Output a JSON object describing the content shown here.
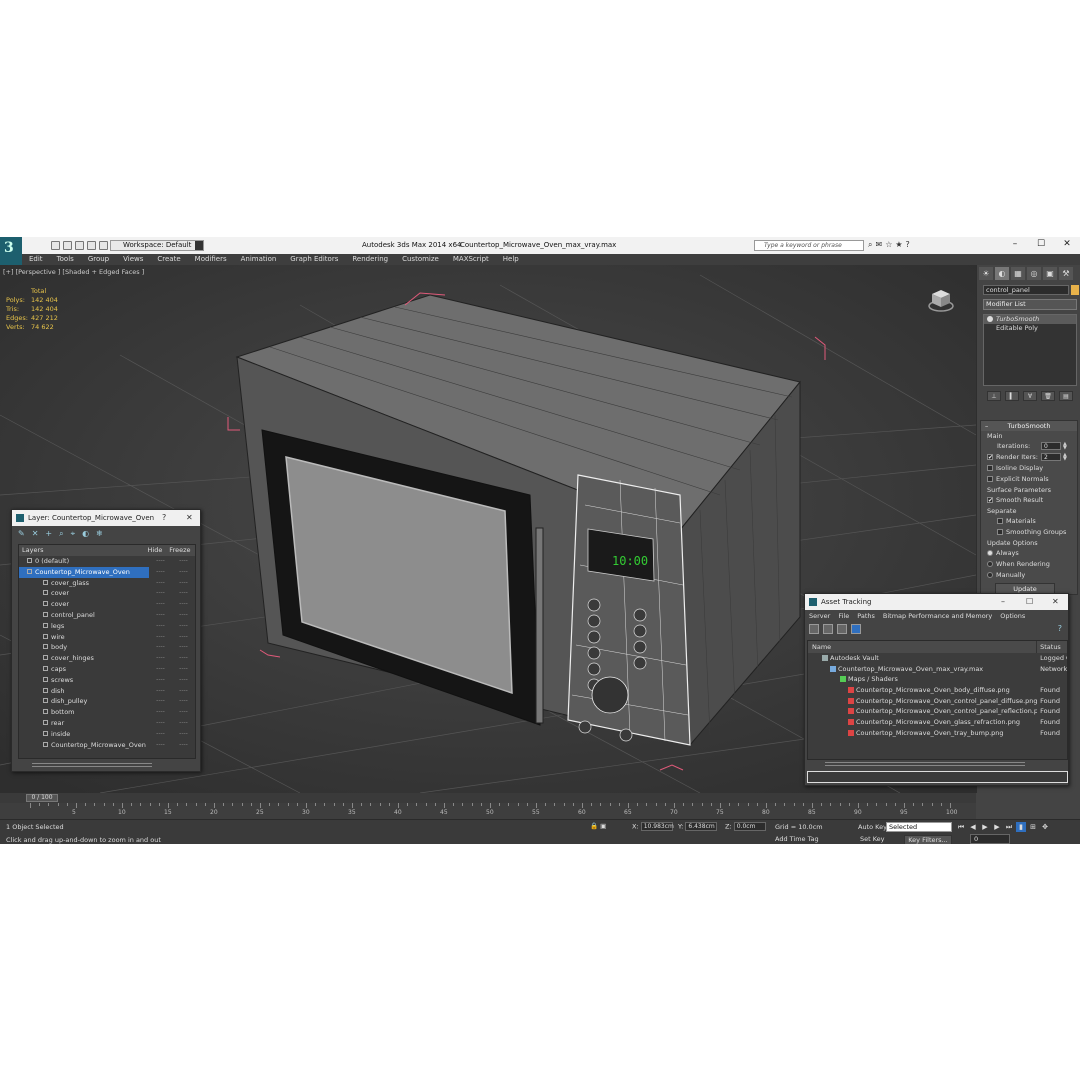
{
  "titlebar": {
    "workspace": "Workspace: Default",
    "app_title": "Autodesk 3ds Max  2014 x64",
    "file_title": "Countertop_Microwave_Oven_max_vray.max",
    "search_placeholder": "Type a keyword or phrase",
    "help": "?",
    "minimize": "–",
    "maximize": "☐",
    "close": "✕"
  },
  "menu": [
    "Edit",
    "Tools",
    "Group",
    "Views",
    "Create",
    "Modifiers",
    "Animation",
    "Graph Editors",
    "Rendering",
    "Customize",
    "MAXScript",
    "Help"
  ],
  "viewport": {
    "label": "[+] [Perspective ] [Shaded + Edged Faces ]",
    "stats_header": "Total",
    "stats": [
      {
        "k": "Polys:",
        "v": "142 404"
      },
      {
        "k": "Tris:",
        "v": "142 404"
      },
      {
        "k": "Edges:",
        "v": "427 212"
      },
      {
        "k": "Verts:",
        "v": "74 622"
      }
    ],
    "clock_text": "10:00"
  },
  "command_panel": {
    "object_name": "control_panel",
    "object_color": "#e8b24a",
    "modifier_list": "Modifier List",
    "stack": [
      "TurboSmooth",
      "Editable Poly"
    ],
    "rollout_title": "TurboSmooth",
    "main_group": "Main",
    "iterations_label": "Iterations:",
    "iterations_value": "0",
    "render_iters_label": "Render Iters:",
    "render_iters_value": "2",
    "isoline": "Isoline Display",
    "explicit": "Explicit Normals",
    "surface_group": "Surface Parameters",
    "smooth_result": "Smooth Result",
    "separate": "Separate",
    "materials": "Materials",
    "smoothing_groups": "Smoothing Groups",
    "update_group": "Update Options",
    "always": "Always",
    "when_rendering": "When Rendering",
    "manually": "Manually",
    "update_button": "Update"
  },
  "layer_window": {
    "title": "Layer: Countertop_Microwave_Oven",
    "help": "?",
    "close": "✕",
    "col_layers": "Layers",
    "col_hide": "Hide",
    "col_freeze": "Freeze",
    "rows": [
      {
        "name": "0 (default)",
        "type": "layer"
      },
      {
        "name": "Countertop_Microwave_Oven",
        "type": "layer-sel"
      },
      {
        "name": "cover_glass",
        "type": "obj"
      },
      {
        "name": "cover",
        "type": "obj"
      },
      {
        "name": "cover",
        "type": "obj"
      },
      {
        "name": "control_panel",
        "type": "obj"
      },
      {
        "name": "legs",
        "type": "obj"
      },
      {
        "name": "wire",
        "type": "obj"
      },
      {
        "name": "body",
        "type": "obj"
      },
      {
        "name": "cover_hinges",
        "type": "obj"
      },
      {
        "name": "caps",
        "type": "obj"
      },
      {
        "name": "screws",
        "type": "obj"
      },
      {
        "name": "dish",
        "type": "obj"
      },
      {
        "name": "dish_pulley",
        "type": "obj"
      },
      {
        "name": "bottom",
        "type": "obj"
      },
      {
        "name": "rear",
        "type": "obj"
      },
      {
        "name": "inside",
        "type": "obj"
      },
      {
        "name": "Countertop_Microwave_Oven",
        "type": "obj"
      }
    ],
    "dash": "----"
  },
  "asset_window": {
    "title": "Asset Tracking",
    "minimize": "–",
    "maximize": "☐",
    "close": "✕",
    "menu": [
      "Server",
      "File",
      "Paths",
      "Bitmap Performance and Memory",
      "Options"
    ],
    "col_name": "Name",
    "col_status": "Status",
    "rows": [
      {
        "name": "Autodesk Vault",
        "status": "Logged Out",
        "indent": 14,
        "color": "#9aa"
      },
      {
        "name": "Countertop_Microwave_Oven_max_vray.max",
        "status": "Network",
        "indent": 22,
        "color": "#7ad"
      },
      {
        "name": "Maps / Shaders",
        "status": "",
        "indent": 32,
        "color": "#5c5"
      },
      {
        "name": "Countertop_Microwave_Oven_body_diffuse.png",
        "status": "Found",
        "indent": 40,
        "color": "#d44"
      },
      {
        "name": "Countertop_Microwave_Oven_control_panel_diffuse.png",
        "status": "Found",
        "indent": 40,
        "color": "#d44"
      },
      {
        "name": "Countertop_Microwave_Oven_control_panel_reflection.png",
        "status": "Found",
        "indent": 40,
        "color": "#d44"
      },
      {
        "name": "Countertop_Microwave_Oven_glass_refraction.png",
        "status": "Found",
        "indent": 40,
        "color": "#d44"
      },
      {
        "name": "Countertop_Microwave_Oven_tray_bump.png",
        "status": "Found",
        "indent": 40,
        "color": "#d44"
      }
    ]
  },
  "timeline": {
    "frame": "0 / 100",
    "ticks": [
      "5",
      "10",
      "15",
      "20",
      "25",
      "30",
      "35",
      "40",
      "45",
      "50",
      "55",
      "60",
      "65",
      "70",
      "75",
      "80",
      "85",
      "90",
      "95",
      "100"
    ]
  },
  "status": {
    "selected": "1 Object Selected",
    "hint": "Click and drag up-and-down to zoom in and out",
    "x_label": "X:",
    "x_value": "10.983cm",
    "y_label": "Y:",
    "y_value": "6.438cm",
    "z_label": "Z:",
    "z_value": "0.0cm",
    "grid": "Grid = 10.0cm",
    "add_time_tag": "Add Time Tag",
    "auto_key": "Auto Key",
    "set_key": "Set Key",
    "selected_dropdown": "Selected",
    "key_filters": "Key Filters...",
    "frame_field": "0"
  }
}
